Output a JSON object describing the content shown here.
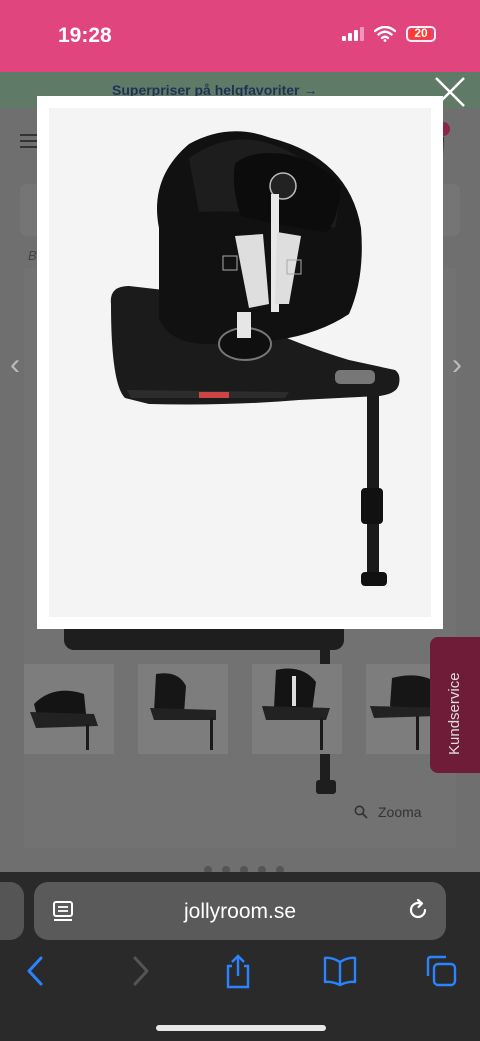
{
  "status_bar": {
    "time": "19:28",
    "battery": "20"
  },
  "promo": {
    "text": "Superpriser på helgfavoriter →"
  },
  "breadcrumb": {
    "text": "B"
  },
  "zoom_label": "Zooma",
  "customer_service_label": "Kundservice",
  "browser": {
    "url": "jollyroom.se"
  },
  "colors": {
    "status_bar": "#e0457e",
    "customer_service": "#6e1c38",
    "ios_blue": "#2a84ff"
  },
  "icons": [
    "signal-icon",
    "wifi-icon",
    "battery-icon",
    "close-icon",
    "menu-icon",
    "cart-icon",
    "chevron-left-icon",
    "chevron-right-icon",
    "search-icon",
    "reader-icon",
    "reload-icon",
    "back-icon",
    "forward-icon",
    "share-icon",
    "bookmarks-icon",
    "tabs-icon"
  ]
}
